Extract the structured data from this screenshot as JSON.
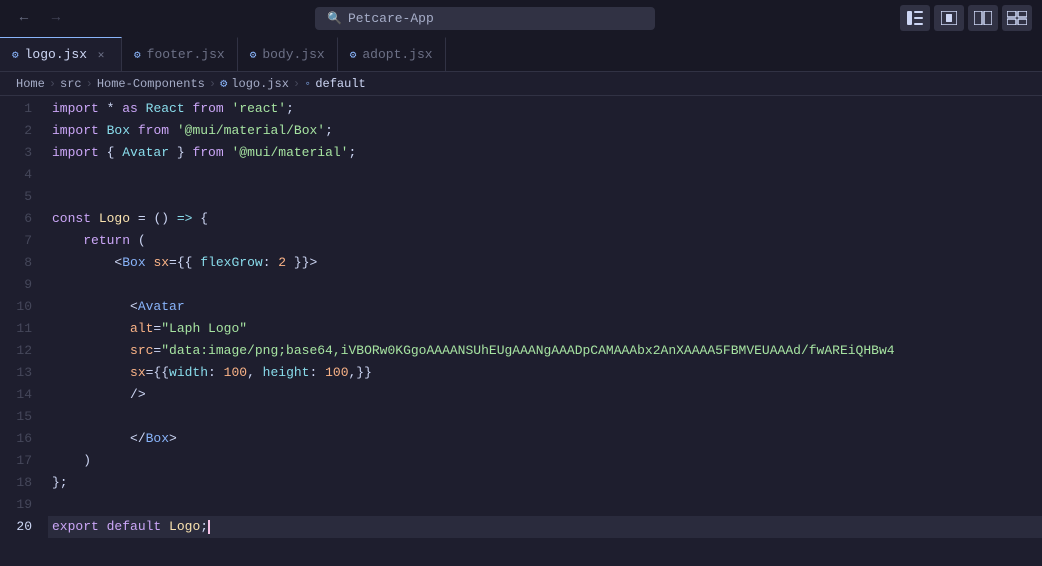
{
  "titlebar": {
    "back_label": "←",
    "forward_label": "→",
    "search_placeholder": "Petcare-App",
    "actions": [
      "sidebar-toggle",
      "editor-layout",
      "split-editor",
      "more-layout"
    ]
  },
  "tabs": [
    {
      "id": "logo",
      "label": "logo.jsx",
      "icon": "⚙",
      "active": true,
      "closeable": true
    },
    {
      "id": "footer",
      "label": "footer.jsx",
      "icon": "⚙",
      "active": false,
      "closeable": false
    },
    {
      "id": "body",
      "label": "body.jsx",
      "icon": "⚙",
      "active": false,
      "closeable": false
    },
    {
      "id": "adopt",
      "label": "adopt.jsx",
      "icon": "⚙",
      "active": false,
      "closeable": false
    }
  ],
  "breadcrumb": {
    "items": [
      "Home",
      "src",
      "Home-Components",
      "logo.jsx",
      "default"
    ]
  },
  "code": {
    "lines": [
      {
        "num": 1,
        "content": "import_star_react"
      },
      {
        "num": 2,
        "content": "import_box"
      },
      {
        "num": 3,
        "content": "import_avatar"
      },
      {
        "num": 4,
        "content": "empty"
      },
      {
        "num": 5,
        "content": "empty"
      },
      {
        "num": 6,
        "content": "const_logo"
      },
      {
        "num": 7,
        "content": "return"
      },
      {
        "num": 8,
        "content": "box_open"
      },
      {
        "num": 9,
        "content": "empty"
      },
      {
        "num": 10,
        "content": "avatar_open"
      },
      {
        "num": 11,
        "content": "alt_attr"
      },
      {
        "num": 12,
        "content": "src_attr"
      },
      {
        "num": 13,
        "content": "sx_attr"
      },
      {
        "num": 14,
        "content": "self_close"
      },
      {
        "num": 15,
        "content": "empty"
      },
      {
        "num": 16,
        "content": "box_close"
      },
      {
        "num": 17,
        "content": "paren_close"
      },
      {
        "num": 18,
        "content": "semicolon"
      },
      {
        "num": 19,
        "content": "empty"
      },
      {
        "num": 20,
        "content": "export_default"
      }
    ]
  }
}
